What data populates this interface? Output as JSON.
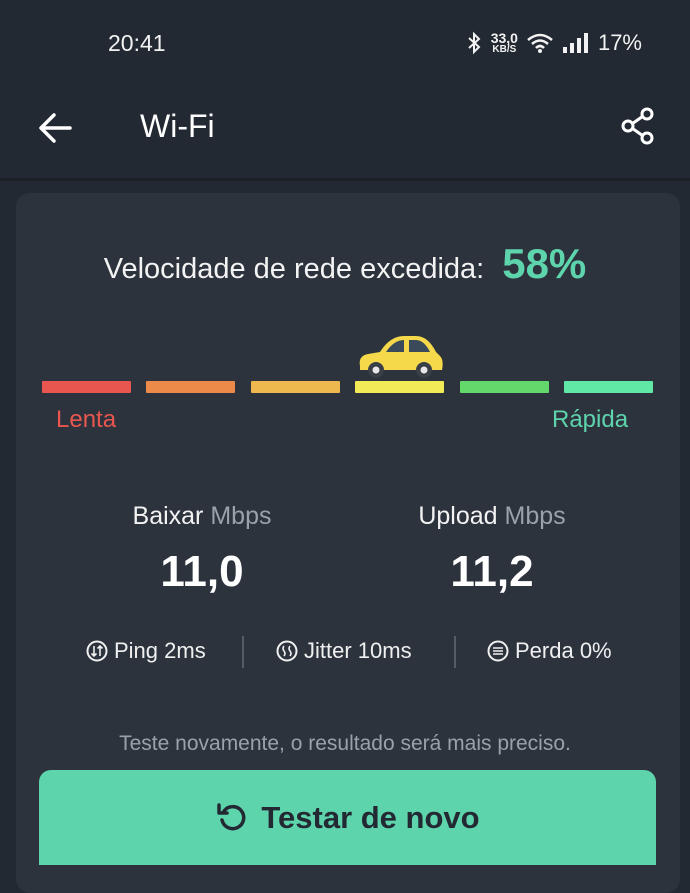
{
  "status_bar": {
    "time": "20:41",
    "net_speed_value": "33,0",
    "net_speed_unit": "KB/S",
    "battery": "17%"
  },
  "app_bar": {
    "title": "Wi-Fi"
  },
  "result": {
    "label": "Velocidade de rede excedida:",
    "percent": "58%",
    "speed_scale": {
      "slow_label": "Lenta",
      "fast_label": "Rápida",
      "segment_colors": [
        "#e8564f",
        "#ec8a4a",
        "#eeb84e",
        "#f3ea58",
        "#62d96a",
        "#5fe8a6"
      ],
      "marker_segment_index": 3
    }
  },
  "metrics": {
    "download": {
      "label": "Baixar",
      "unit": "Mbps",
      "value": "11,0"
    },
    "upload": {
      "label": "Upload",
      "unit": "Mbps",
      "value": "11,2"
    }
  },
  "stats": {
    "ping": "Ping 2ms",
    "jitter": "Jitter 10ms",
    "loss": "Perda 0%"
  },
  "hint": "Teste novamente, o resultado será mais preciso.",
  "retest_button": {
    "label": "Testar de novo"
  },
  "colors": {
    "accent": "#5ed4ad",
    "background": "#232932",
    "card": "#2c333d"
  },
  "icons": {
    "back": "arrow-left-icon",
    "share": "share-icon",
    "car": "car-icon",
    "ping": "ping-icon",
    "jitter": "jitter-icon",
    "loss": "loss-icon",
    "retest": "refresh-icon"
  }
}
